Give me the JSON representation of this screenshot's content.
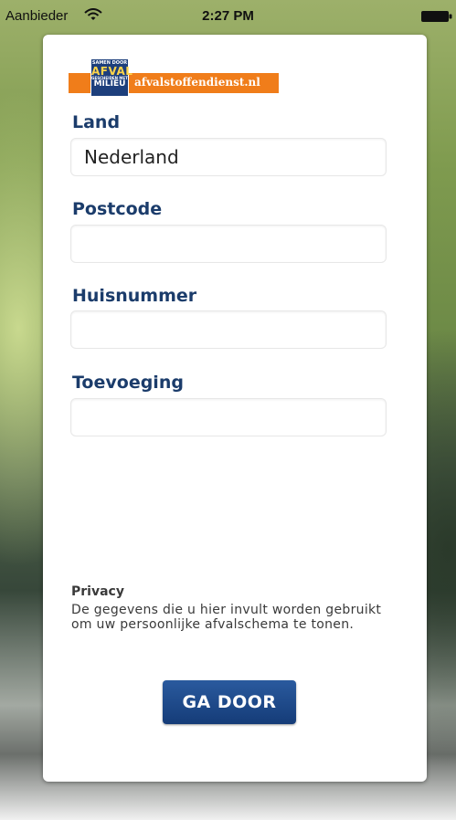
{
  "status_bar": {
    "carrier": "Aanbieder",
    "time": "2:27 PM",
    "wifi_icon": "wifi-icon",
    "battery_icon": "battery-icon"
  },
  "logo": {
    "badge_lines": [
      "SAMEN DOOR",
      "AFVAL",
      "GESCHEIDEN MET",
      "MILIEU"
    ],
    "site_name": "afvalstoffendienst.nl",
    "colors": {
      "bar": "#f07d1a",
      "badge": "#1d3f7c"
    }
  },
  "form": {
    "land": {
      "label": "Land",
      "value": "Nederland",
      "placeholder": ""
    },
    "postcode": {
      "label": "Postcode",
      "value": "",
      "placeholder": ""
    },
    "huisnummer": {
      "label": "Huisnummer",
      "value": "",
      "placeholder": ""
    },
    "toevoeging": {
      "label": "Toevoeging",
      "value": "",
      "placeholder": ""
    }
  },
  "privacy": {
    "title": "Privacy",
    "text": "De gegevens die u hier invult worden gebruikt om uw persoonlijke afvalschema te tonen."
  },
  "actions": {
    "continue_label": "GA DOOR"
  },
  "colors": {
    "label": "#1b3c6b",
    "button": "#1f4a8a"
  }
}
